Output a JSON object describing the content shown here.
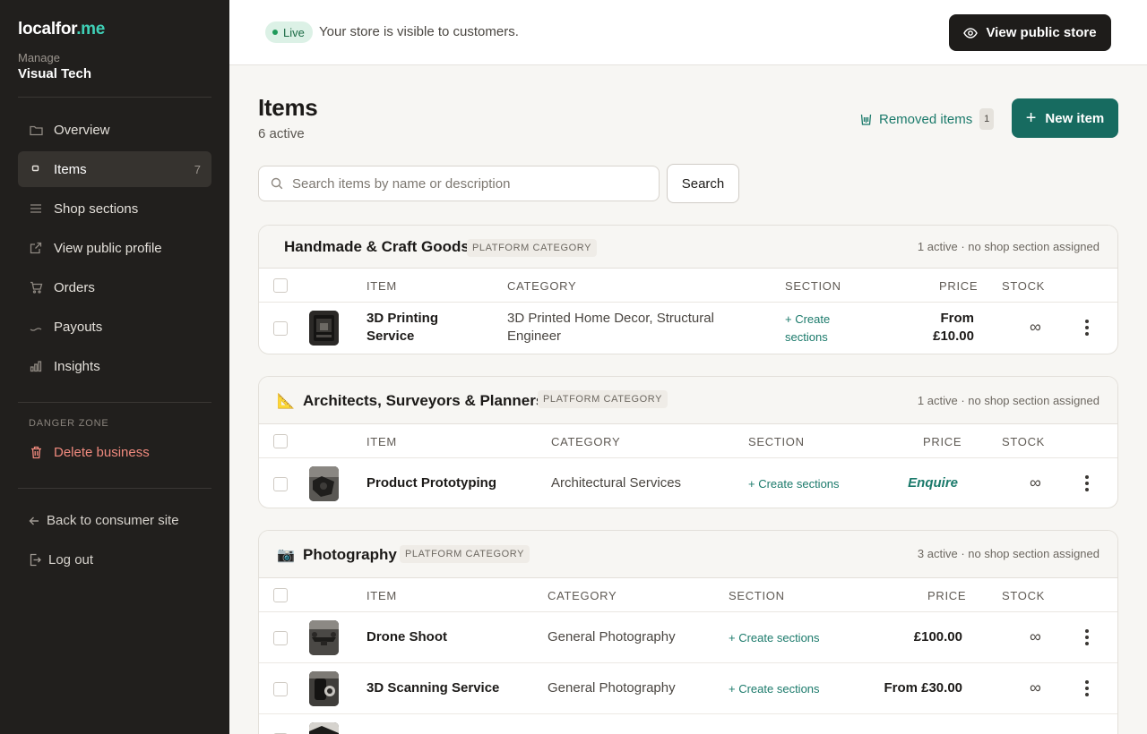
{
  "sidebar": {
    "brand_main": "localfor",
    "brand_accent": ".me",
    "manage_label": "Manage",
    "business_name": "Visual Tech",
    "nav": [
      {
        "label": "Overview",
        "icon": "folder-icon"
      },
      {
        "label": "Items",
        "icon": "item-icon",
        "count": "7"
      },
      {
        "label": "Shop sections",
        "icon": "list-icon"
      },
      {
        "label": "View public profile",
        "icon": "external-link-icon"
      },
      {
        "label": "Orders",
        "icon": "cart-icon"
      },
      {
        "label": "Payouts",
        "icon": "payout-icon"
      },
      {
        "label": "Insights",
        "icon": "bar-chart-icon"
      }
    ],
    "danger_label": "DANGER ZONE",
    "delete_label": "Delete business",
    "back_label": "Back to consumer site",
    "logout_label": "Log out"
  },
  "topbar": {
    "live_badge": "Live",
    "live_text": "Your store is visible to customers.",
    "view_store_label": "View public store"
  },
  "main": {
    "title": "Items",
    "subtitle": "6 active",
    "removed_label": "Removed items",
    "removed_count": "1",
    "new_item_label": "New item",
    "search_placeholder": "Search items by name or description",
    "search_button": "Search"
  },
  "groups": [
    {
      "title": "Handmade & Craft Goods",
      "emoji": "",
      "badge": "PLATFORM CATEGORY",
      "meta": "1 active · no shop section assigned",
      "headers": {
        "item": "ITEM",
        "category": "CATEGORY",
        "section": "SECTION",
        "price": "PRICE",
        "stock": "STOCK"
      },
      "rows": [
        {
          "name": "3D Printing Service",
          "category": "3D Printed Home Decor, Structural Engineer",
          "section": "+ Create sections",
          "price": "From £10.00",
          "stock": "∞"
        }
      ]
    },
    {
      "title": "Architects, Surveyors & Planners",
      "emoji": "📐",
      "badge": "PLATFORM CATEGORY",
      "meta": "1 active · no shop section assigned",
      "headers": {
        "item": "ITEM",
        "category": "CATEGORY",
        "section": "SECTION",
        "price": "PRICE",
        "stock": "STOCK"
      },
      "rows": [
        {
          "name": "Product Prototyping",
          "category": "Architectural Services",
          "section": "+ Create sections",
          "price": "Enquire",
          "stock": "∞"
        }
      ]
    },
    {
      "title": "Photography",
      "emoji": "📷",
      "badge": "PLATFORM CATEGORY",
      "meta": "3 active · no shop section assigned",
      "headers": {
        "item": "ITEM",
        "category": "CATEGORY",
        "section": "SECTION",
        "price": "PRICE",
        "stock": "STOCK"
      },
      "rows": [
        {
          "name": "Drone Shoot",
          "category": "General Photography",
          "section": "+ Create sections",
          "price": "£100.00",
          "stock": "∞"
        },
        {
          "name": "3D Scanning Service",
          "category": "General Photography",
          "section": "+ Create sections",
          "price": "From £30.00",
          "stock": "∞"
        }
      ]
    }
  ],
  "colors": {
    "sidebar_bg": "#211f1d",
    "accent_teal": "#176b60",
    "brand_accent": "#3fd0b7",
    "danger": "#f08a7e"
  }
}
